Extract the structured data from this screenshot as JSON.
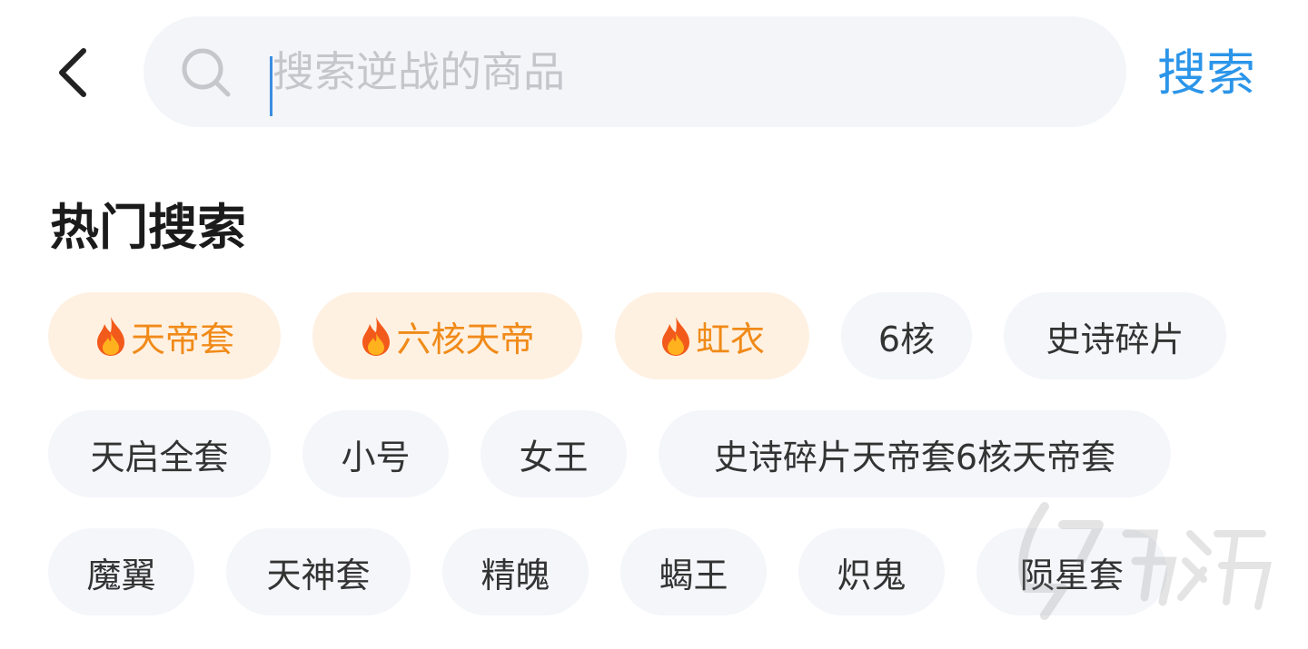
{
  "header": {
    "search_placeholder": "搜索逆战的商品",
    "search_button_label": "搜索"
  },
  "hot_search": {
    "title": "热门搜索",
    "tags": [
      {
        "label": "天帝套",
        "hot": true
      },
      {
        "label": "六核天帝",
        "hot": true
      },
      {
        "label": "虹衣",
        "hot": true
      },
      {
        "label": "6核",
        "hot": false
      },
      {
        "label": "史诗碎片",
        "hot": false
      },
      {
        "label": "天启全套",
        "hot": false
      },
      {
        "label": "小号",
        "hot": false
      },
      {
        "label": "女王",
        "hot": false
      },
      {
        "label": "史诗碎片天帝套6核天帝套",
        "hot": false
      },
      {
        "label": "魔翼",
        "hot": false
      },
      {
        "label": "天神套",
        "hot": false
      },
      {
        "label": "精魄",
        "hot": false
      },
      {
        "label": "蝎王",
        "hot": false
      },
      {
        "label": "炽鬼",
        "hot": false
      },
      {
        "label": "陨星套",
        "hot": false
      }
    ]
  },
  "icons": {
    "back": "chevron-left-icon",
    "search": "search-icon",
    "hot": "fire-icon"
  },
  "colors": {
    "accent": "#2b95e9",
    "hot_text": "#f08a18",
    "hot_bg": "#fff1e2",
    "tag_bg": "#f4f6fa",
    "search_bg": "#f3f5f9"
  }
}
